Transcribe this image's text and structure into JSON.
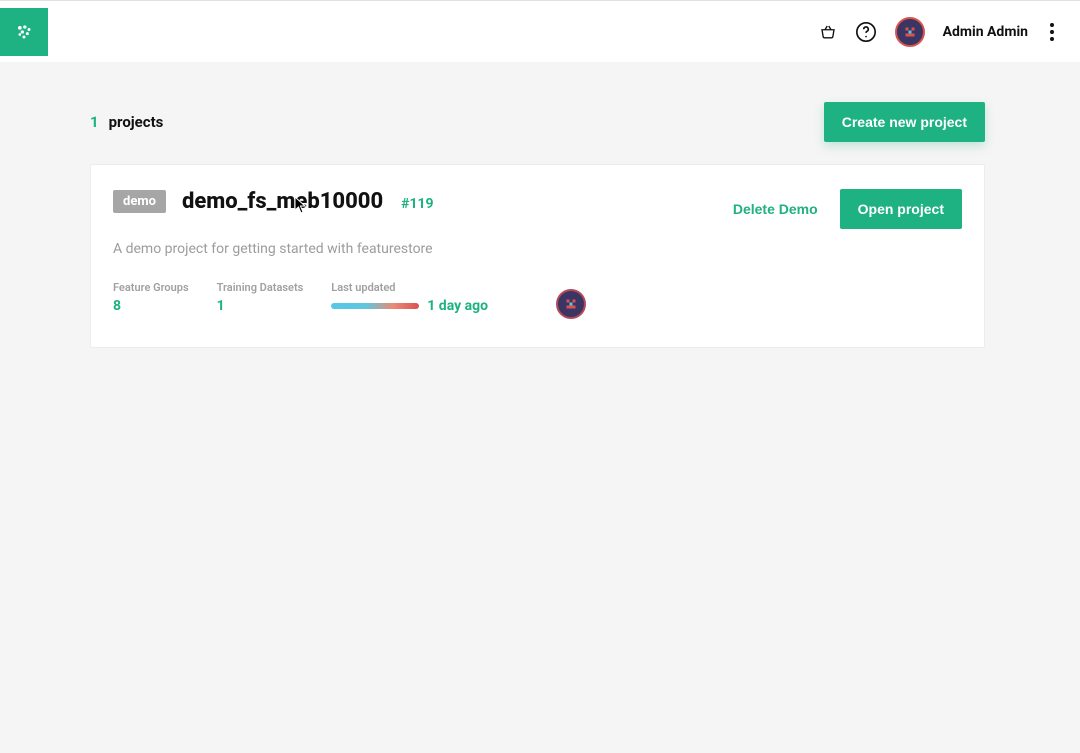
{
  "header": {
    "username": "Admin Admin"
  },
  "list": {
    "count": "1",
    "label": "projects",
    "create_btn": "Create new project"
  },
  "project": {
    "badge": "demo",
    "name": "demo_fs_meb10000",
    "id": "#119",
    "description": "A demo project for getting started with featurestore",
    "delete_label": "Delete Demo",
    "open_label": "Open project",
    "stats": {
      "feature_groups_label": "Feature Groups",
      "feature_groups_value": "8",
      "training_datasets_label": "Training Datasets",
      "training_datasets_value": "1",
      "last_updated_label": "Last updated",
      "last_updated_value": "1 day ago"
    }
  }
}
